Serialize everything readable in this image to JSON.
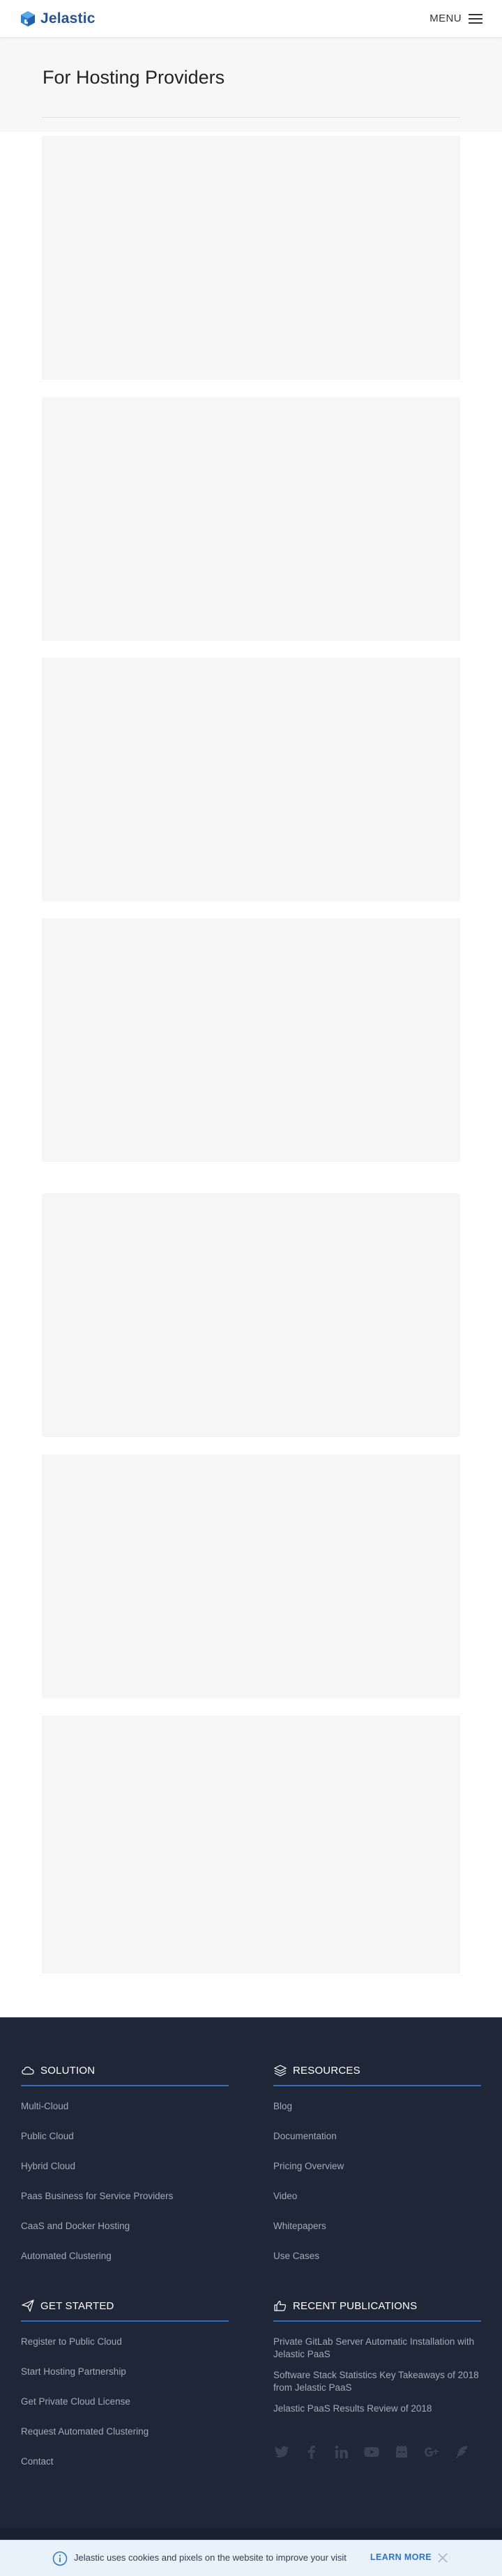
{
  "header": {
    "logo_text": "Jelastic",
    "menu_label": "MENU"
  },
  "hero": {
    "title": "For Hosting Providers"
  },
  "footer": {
    "solution": {
      "heading": "SOLUTION",
      "links": [
        "Multi-Cloud",
        "Public Cloud",
        "Hybrid Cloud",
        "Paas Business for Service Providers",
        "CaaS and Docker Hosting",
        "Automated Clustering"
      ]
    },
    "resources": {
      "heading": "RESOURCES",
      "links": [
        "Blog",
        "Documentation",
        "Pricing Overview",
        "Video",
        "Whitepapers",
        "Use Cases"
      ]
    },
    "get_started": {
      "heading": "GET STARTED",
      "links": [
        "Register to Public Cloud",
        "Start Hosting Partnership",
        "Get Private Cloud License",
        "Request Automated Clustering",
        "Contact"
      ]
    },
    "recent_publications": {
      "heading": "RECENT PUBLICATIONS",
      "links": [
        "Private GitLab Server Automatic Installation with Jelastic PaaS",
        "Software Stack Statistics Key Takeaways of 2018 from Jelastic PaaS",
        "Jelastic PaaS Results Review of 2018"
      ]
    },
    "social_icons": [
      "twitter-icon",
      "facebook-icon",
      "linkedin-icon",
      "youtube-icon",
      "github-icon",
      "google-plus-icon",
      "feather-icon"
    ]
  },
  "cookie_bar": {
    "text": "Jelastic uses cookies and pixels on the website to improve your visit",
    "learn_more": "LEARN MORE"
  },
  "colors": {
    "brand_blue": "#25529a",
    "footer_bg": "#1f2638",
    "accent_line": "#2f6fc1",
    "link_text": "#a3a9b6",
    "cookie_bg": "#e9f1fb"
  }
}
